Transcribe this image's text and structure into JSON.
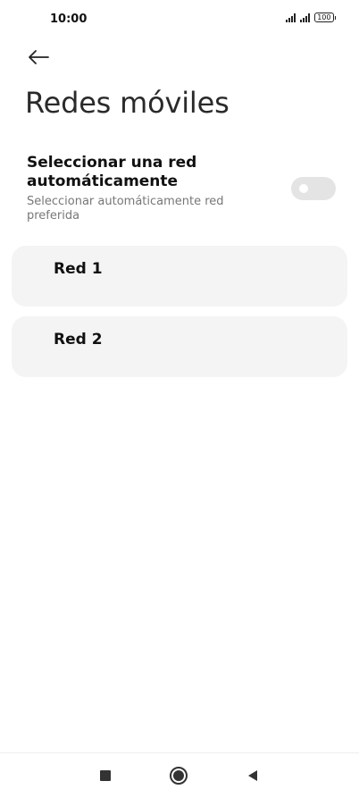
{
  "status_bar": {
    "time": "10:00",
    "battery_level": "100",
    "signal_icons": [
      "signal-1-icon",
      "signal-2-icon"
    ]
  },
  "header": {
    "back_icon": "arrow-left-icon",
    "title": "Redes móviles"
  },
  "auto_select": {
    "title": "Seleccionar una red automáticamente",
    "subtitle": "Seleccionar automáticamente red preferida",
    "enabled": false
  },
  "networks": [
    {
      "label": "Red 1"
    },
    {
      "label": "Red 2"
    }
  ],
  "nav_bar": {
    "recents_icon": "square-icon",
    "home_icon": "circle-icon",
    "back_icon": "triangle-left-icon"
  },
  "colors": {
    "background": "#ffffff",
    "card_background": "#f4f4f4",
    "toggle_off": "#e4e4e4",
    "subtitle_text": "#777777"
  }
}
